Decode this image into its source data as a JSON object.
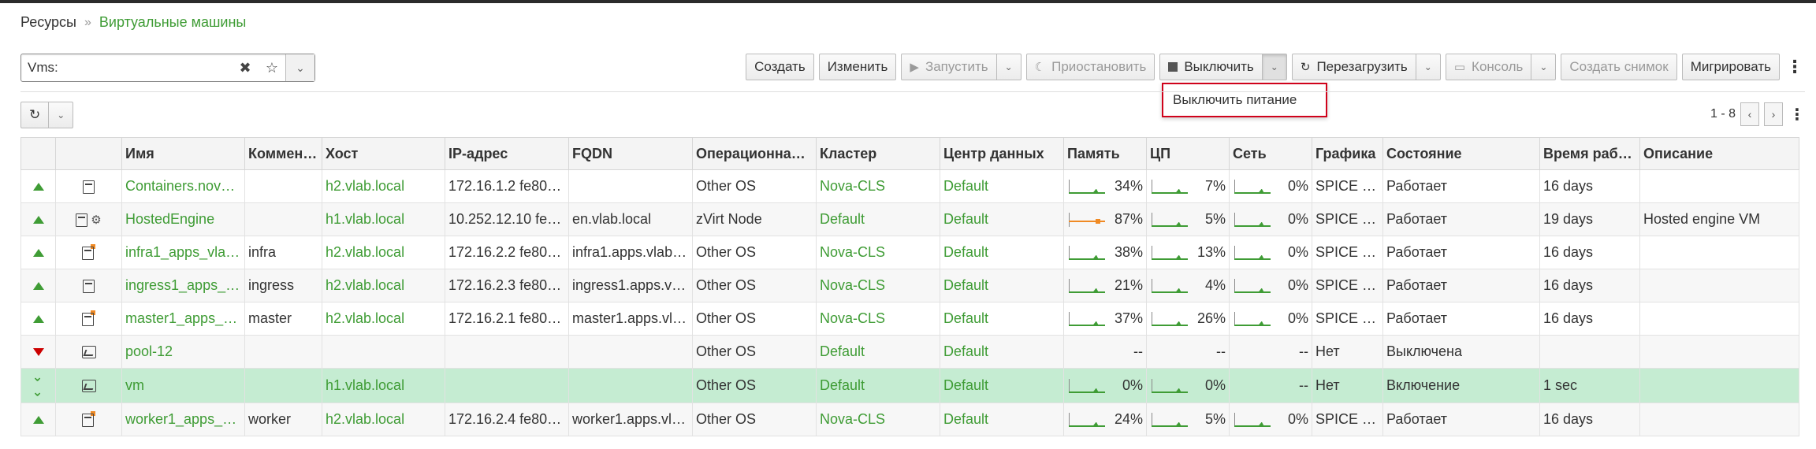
{
  "breadcrumb": {
    "root": "Ресурсы",
    "separator": "»",
    "current": "Виртуальные машины"
  },
  "search": {
    "value": "Vms:"
  },
  "toolbar": {
    "create": "Создать",
    "edit": "Изменить",
    "run": "Запустить",
    "suspend": "Приостановить",
    "shutdown": "Выключить",
    "reboot": "Перезагрузить",
    "console": "Консоль",
    "snapshot": "Создать снимок",
    "migrate": "Мигрировать"
  },
  "dropdown": {
    "item": "Выключить питание"
  },
  "pager": {
    "range": "1 - 8"
  },
  "table": {
    "headers": [
      "",
      "",
      "Имя",
      "Коммен…",
      "Хост",
      "IP-адрес",
      "FQDN",
      "Операционная…",
      "Кластер",
      "Центр данных",
      "Память",
      "ЦП",
      "Сеть",
      "Графика",
      "Состояние",
      "Время рабо…",
      "Описание"
    ],
    "rows": [
      {
        "status": "up",
        "icons": "vm",
        "name": "Containers.nova…",
        "comment": "",
        "host": "h2.vlab.local",
        "ip": "172.16.1.2 fe80:…",
        "fqdn": "",
        "os": "Other OS",
        "cluster": "Nova-CLS",
        "dc": "Default",
        "mem": "34%",
        "cpu": "7%",
        "net": "0%",
        "graphics": "SPICE + …",
        "state": "Работает",
        "uptime": "16 days",
        "desc": ""
      },
      {
        "status": "up",
        "icons": "vm-engine",
        "name": "HostedEngine",
        "comment": "",
        "host": "h1.vlab.local",
        "ip": "10.252.12.10 fe8…",
        "fqdn": "en.vlab.local",
        "os": "zVirt Node",
        "cluster": "Default",
        "dc": "Default",
        "mem": "87%",
        "cpu": "5%",
        "net": "0%",
        "graphics": "SPICE + …",
        "state": "Работает",
        "uptime": "19 days",
        "desc": "Hosted engine VM"
      },
      {
        "status": "up",
        "icons": "pool",
        "name": "infra1_apps_vla…",
        "comment": "infra",
        "host": "h2.vlab.local",
        "ip": "172.16.2.2 fe80:…",
        "fqdn": "infra1.apps.vlab.…",
        "os": "Other OS",
        "cluster": "Nova-CLS",
        "dc": "Default",
        "mem": "38%",
        "cpu": "13%",
        "net": "0%",
        "graphics": "SPICE + …",
        "state": "Работает",
        "uptime": "16 days",
        "desc": ""
      },
      {
        "status": "up",
        "icons": "vm",
        "name": "ingress1_apps_v…",
        "comment": "ingress",
        "host": "h2.vlab.local",
        "ip": "172.16.2.3 fe80:…",
        "fqdn": "ingress1.apps.vl…",
        "os": "Other OS",
        "cluster": "Nova-CLS",
        "dc": "Default",
        "mem": "21%",
        "cpu": "4%",
        "net": "0%",
        "graphics": "SPICE + …",
        "state": "Работает",
        "uptime": "16 days",
        "desc": ""
      },
      {
        "status": "up",
        "icons": "pool",
        "name": "master1_apps_vl…",
        "comment": "master",
        "host": "h2.vlab.local",
        "ip": "172.16.2.1 fe80:…",
        "fqdn": "master1.apps.vl…",
        "os": "Other OS",
        "cluster": "Nova-CLS",
        "dc": "Default",
        "mem": "37%",
        "cpu": "26%",
        "net": "0%",
        "graphics": "SPICE + …",
        "state": "Работает",
        "uptime": "16 days",
        "desc": ""
      },
      {
        "status": "down",
        "icons": "template",
        "name": "pool-12",
        "comment": "",
        "host": "",
        "ip": "",
        "fqdn": "",
        "os": "Other OS",
        "cluster": "Default",
        "dc": "Default",
        "mem": "--",
        "cpu": "--",
        "net": "--",
        "graphics": "Нет",
        "state": "Выключена",
        "uptime": "",
        "desc": ""
      },
      {
        "status": "powering",
        "icons": "template",
        "name": "vm",
        "comment": "",
        "host": "h1.vlab.local",
        "ip": "",
        "fqdn": "",
        "os": "Other OS",
        "cluster": "Default",
        "dc": "Default",
        "mem": "0%",
        "cpu": "0%",
        "net": "--",
        "graphics": "Нет",
        "state": "Включение",
        "uptime": "1 sec",
        "desc": "",
        "selected": true
      },
      {
        "status": "up",
        "icons": "pool",
        "name": "worker1_apps_vl…",
        "comment": "worker",
        "host": "h2.vlab.local",
        "ip": "172.16.2.4 fe80:…",
        "fqdn": "worker1.apps.vl…",
        "os": "Other OS",
        "cluster": "Nova-CLS",
        "dc": "Default",
        "mem": "24%",
        "cpu": "5%",
        "net": "0%",
        "graphics": "SPICE + …",
        "state": "Работает",
        "uptime": "16 days",
        "desc": ""
      }
    ]
  },
  "colors": {
    "accent": "#3f9c35",
    "selected_row": "#c5ecd2",
    "dropdown_border": "#d0021b",
    "status_down": "#cc0000"
  }
}
